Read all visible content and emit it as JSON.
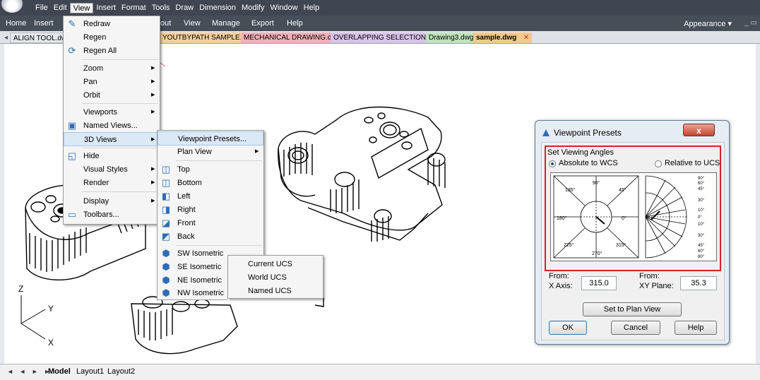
{
  "menubar": [
    "File",
    "Edit",
    "View",
    "Insert",
    "Format",
    "Tools",
    "Draw",
    "Dimension",
    "Modify",
    "Window",
    "Help"
  ],
  "ribbon": {
    "tabs": [
      "Home",
      "Insert",
      "out",
      "View",
      "Manage",
      "Export",
      "Help"
    ],
    "appearance": "Appearance"
  },
  "doc_tabs": [
    {
      "label": "ALIGN TOOL.dwg",
      "color": "#e5e8ec"
    },
    {
      "label": "YOUTBYPATH SAMPLE.dwg",
      "color": "#f3cf9a"
    },
    {
      "label": "MECHANICAL DRAWING.dwg",
      "color": "#f2b0b8"
    },
    {
      "label": "OVERLAPPING SELECTION.dwg",
      "color": "#d9c3ea"
    },
    {
      "label": "Drawing3.dwg",
      "color": "#bfe3bc"
    },
    {
      "label": "sample.dwg",
      "color": "#f4c98d"
    }
  ],
  "view_menu": {
    "items": [
      {
        "label": "Redraw",
        "icon": "pencil-icon"
      },
      {
        "label": "Regen",
        "icon": ""
      },
      {
        "label": "Regen All",
        "icon": "regen-all-icon"
      },
      {
        "label": "Zoom",
        "submenu": true
      },
      {
        "label": "Pan",
        "submenu": true
      },
      {
        "label": "Orbit",
        "submenu": true
      },
      {
        "label": "Viewports",
        "submenu": true
      },
      {
        "label": "Named Views...",
        "icon": "named-views-icon"
      },
      {
        "label": "3D Views",
        "submenu": true,
        "highlighted": true
      },
      {
        "label": "Hide",
        "icon": "hide-icon"
      },
      {
        "label": "Visual Styles",
        "submenu": true
      },
      {
        "label": "Render",
        "submenu": true
      },
      {
        "label": "Display",
        "submenu": true
      },
      {
        "label": "Toolbars...",
        "icon": "toolbars-icon"
      }
    ]
  },
  "views3d_menu": {
    "items": [
      "Viewpoint Presets...",
      "Plan View",
      "Top",
      "Bottom",
      "Left",
      "Right",
      "Front",
      "Back",
      "SW Isometric",
      "SE Isometric",
      "NE Isometric",
      "NW Isometric"
    ]
  },
  "plan_menu": {
    "items": [
      "Current UCS",
      "World UCS",
      "Named UCS"
    ]
  },
  "dialog": {
    "title": "Viewpoint Presets",
    "close": "x",
    "section": "Set Viewing Angles",
    "radio_absolute": "Absolute to WCS",
    "radio_relative": "Relative to UCS",
    "from1": "From:",
    "xaxis_label": "X Axis:",
    "xaxis_value": "315.0",
    "from2": "From:",
    "xyplane_label": "XY Plane:",
    "xyplane_value": "35.3",
    "plan_button": "Set to Plan View",
    "ok": "OK",
    "cancel": "Cancel",
    "help": "Help",
    "dial_labels": [
      "90°",
      "45°",
      "0°",
      "315°",
      "270°",
      "225°",
      "180°",
      "135°"
    ],
    "arc_labels": [
      "90°",
      "60°",
      "45°",
      "30°",
      "10°",
      "0°",
      "10°",
      "30°",
      "45°",
      "60°",
      "90°"
    ]
  },
  "ucs_axes": {
    "z": "Z",
    "y": "Y",
    "x": "X"
  },
  "layout_tabs": [
    "Model",
    "Layout1",
    "Layout2"
  ],
  "nav_arrows": "◄ ◄ ► ►"
}
